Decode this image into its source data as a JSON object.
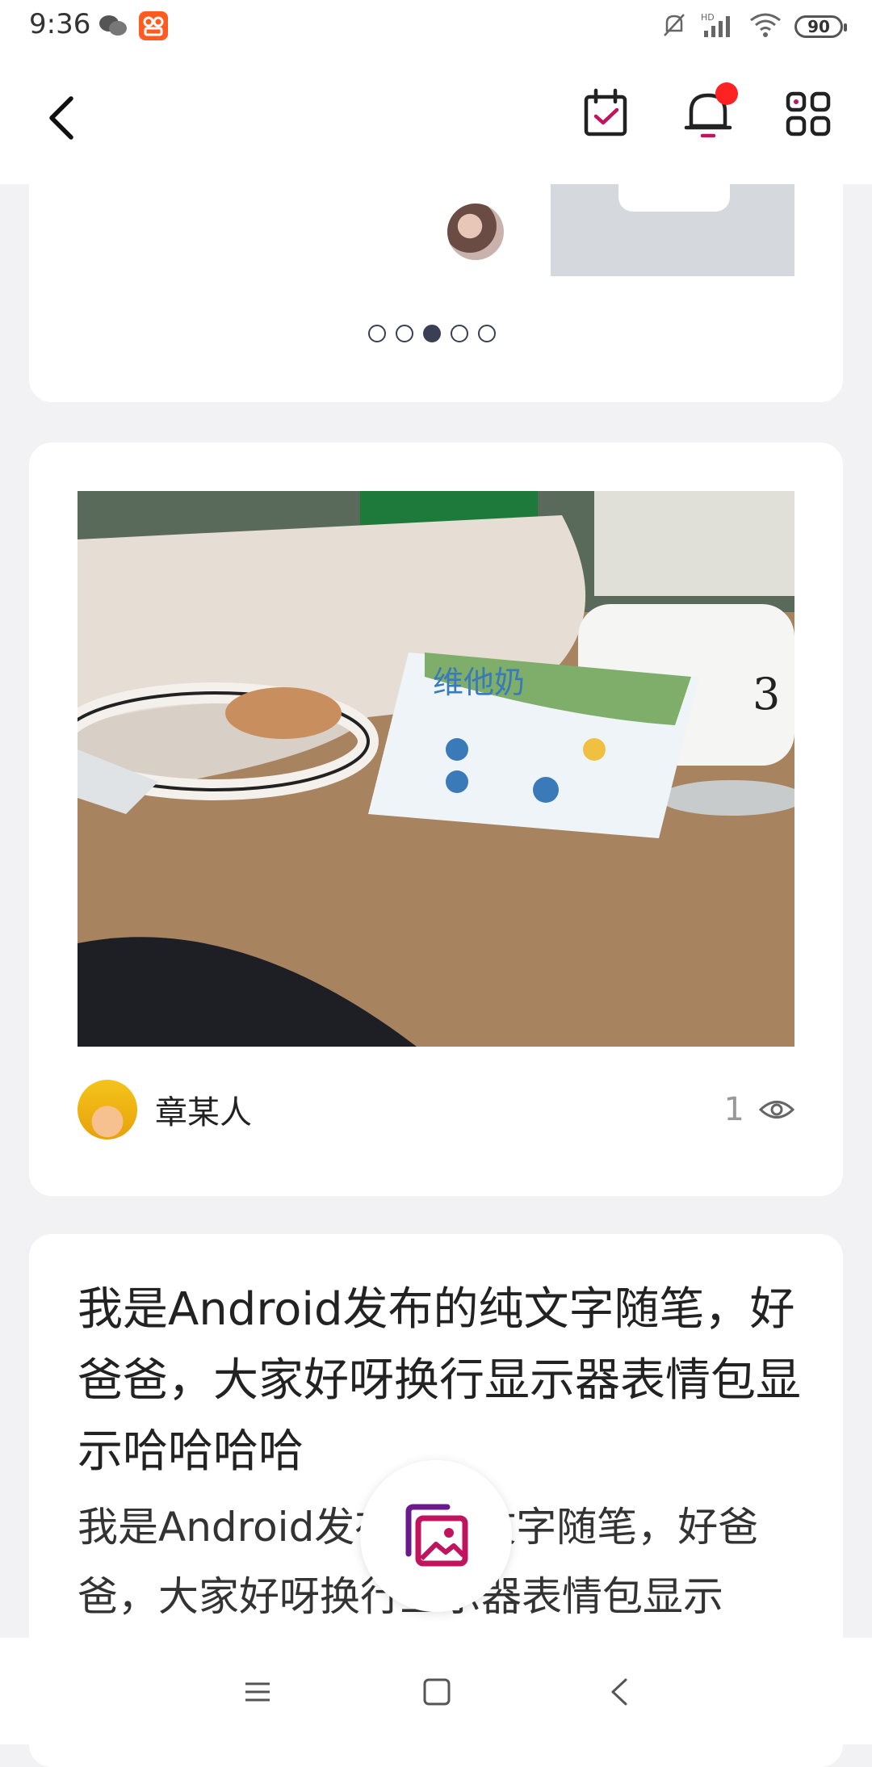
{
  "status_bar": {
    "time": "9:36",
    "battery": "90",
    "icons": [
      "wechat-icon",
      "app-badge-icon",
      "mute-icon",
      "hd-signal-icon",
      "wifi-icon",
      "battery-icon"
    ]
  },
  "app_bar": {
    "icons": [
      "back-icon",
      "checkin-calendar-icon",
      "notification-bell-icon",
      "apps-grid-icon"
    ],
    "notification_dot_color": "#ff2222"
  },
  "carousel": {
    "dot_count": 5,
    "active_index": 2
  },
  "photo_post": {
    "author": "章某人",
    "views": "1"
  },
  "text_post": {
    "title": "我是Android发布的纯文字随笔，好爸爸，大家好呀换行显示器表情包显示哈哈哈哈",
    "body": "我是Android发布的纯文字随笔，好爸爸，大家好呀换行显示器表情包显示"
  },
  "fab": {
    "icon": "gallery-publish-icon",
    "accent": "#c0145f"
  },
  "nav_bar": {
    "icons": [
      "menu-icon",
      "home-icon",
      "back-icon"
    ]
  }
}
